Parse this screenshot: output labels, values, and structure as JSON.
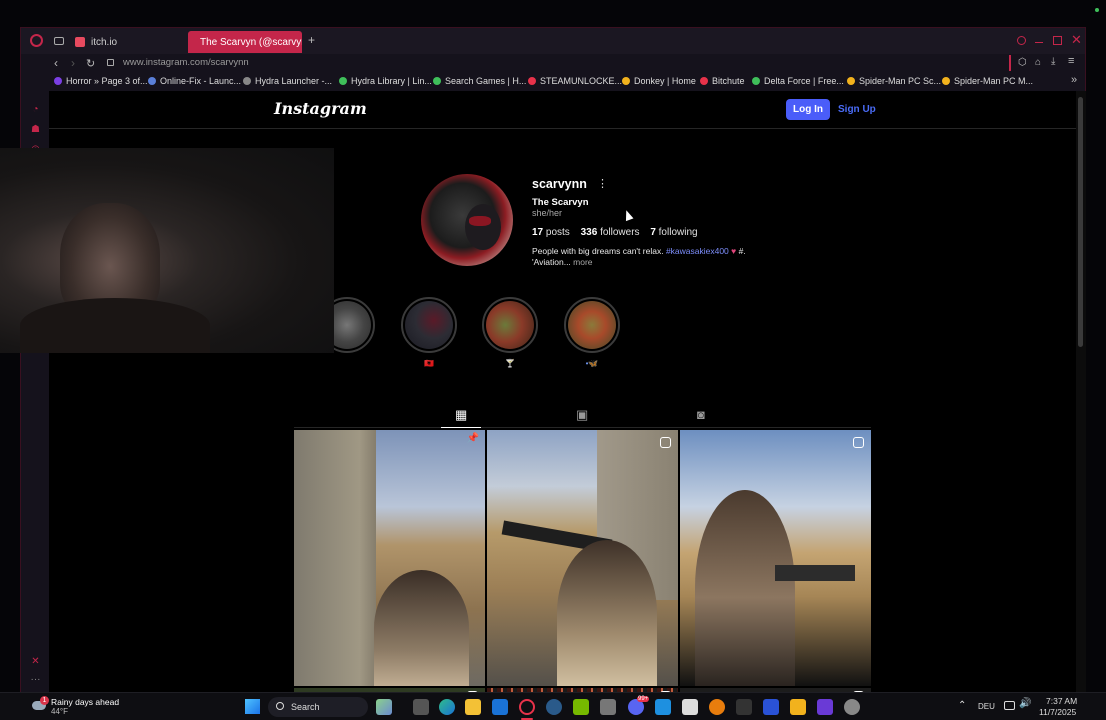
{
  "browser": {
    "tabs": [
      {
        "label": "itch.io",
        "active": false
      },
      {
        "label": "The Scarvyn (@scarvynn",
        "active": true
      }
    ],
    "new_tab_symbol": "+",
    "url": "www.instagram.com/scarvynn",
    "bookmarks": [
      "Horror » Page 3 of...",
      "Online-Fix - Launc...",
      "Hydra Launcher -...",
      "Hydra Library | Lin...",
      "Search Games | H...",
      "STEAMUNLOCKE...",
      "Donkey | Home",
      "Bitchute",
      "Delta Force | Free...",
      "Spider-Man PC Sc...",
      "Spider-Man PC M..."
    ],
    "accent": "#c4264a"
  },
  "instagram": {
    "logo": "Instagram",
    "login_label": "Log In",
    "signup_label": "Sign Up",
    "username": "scarvynn",
    "more_symbol": "⋮",
    "display_name": "The Scarvyn",
    "pronouns": "she/her",
    "stats": {
      "posts_count": "17",
      "posts_label": "posts",
      "followers_count": "336",
      "followers_label": "followers",
      "following_count": "7",
      "following_label": "following"
    },
    "bio_text": "People with big dreams can't relax.",
    "bio_hashtag": "#kawasakiex400",
    "bio_tail": "#.",
    "bio_line2": "'Aviation...",
    "bio_more": "more",
    "highlights": [
      {
        "label": ""
      },
      {
        "label": "🇦🇱"
      },
      {
        "label": "🍸"
      },
      {
        "label": "•🦋"
      }
    ],
    "profile_tabs": [
      "grid-icon",
      "reels-icon",
      "tagged-icon"
    ]
  },
  "taskbar": {
    "weather_title": "Rainy days ahead",
    "weather_temp": "44°F",
    "weather_badge": "1",
    "search_label": "Search",
    "notification_badge": "99+",
    "language": "DEU",
    "time": "7:37 AM",
    "date": "11/7/2025"
  }
}
